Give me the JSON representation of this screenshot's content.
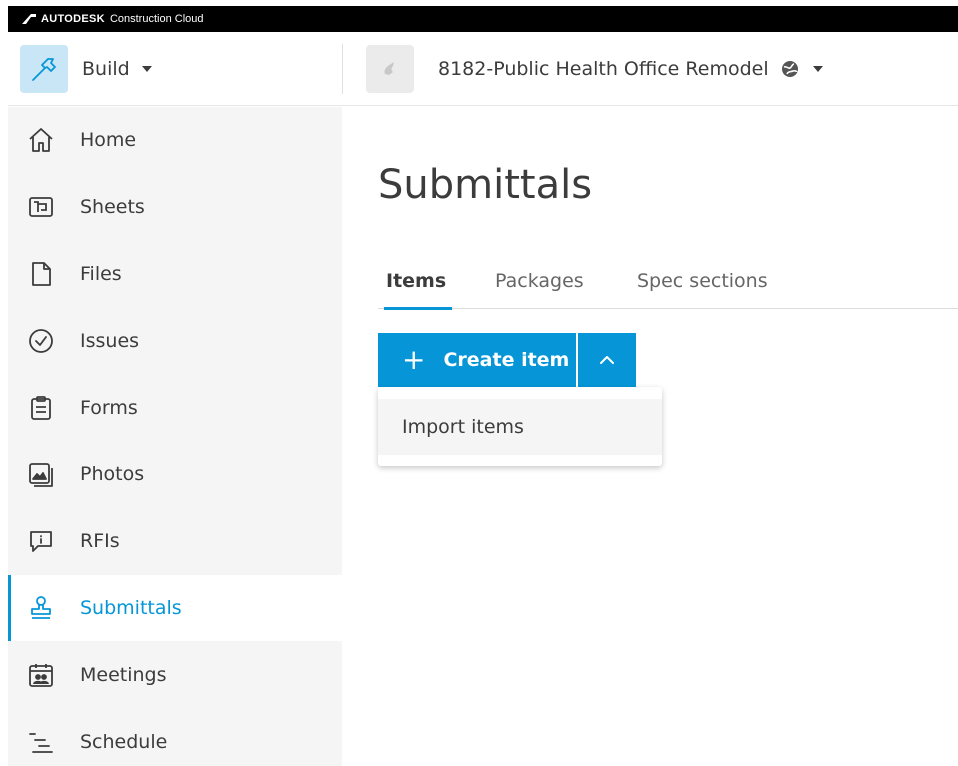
{
  "brand": {
    "name": "AUTODESK",
    "product": "Construction Cloud"
  },
  "header": {
    "app_label": "Build",
    "project_name": "8182-Public Health Office Remodel"
  },
  "sidebar": {
    "items": [
      {
        "label": "Home",
        "icon": "home-icon"
      },
      {
        "label": "Sheets",
        "icon": "sheets-icon"
      },
      {
        "label": "Files",
        "icon": "file-icon"
      },
      {
        "label": "Issues",
        "icon": "issues-check-icon"
      },
      {
        "label": "Forms",
        "icon": "clipboard-icon"
      },
      {
        "label": "Photos",
        "icon": "photos-icon"
      },
      {
        "label": "RFIs",
        "icon": "rfi-speech-icon"
      },
      {
        "label": "Submittals",
        "icon": "stamp-icon",
        "active": true
      },
      {
        "label": "Meetings",
        "icon": "calendar-people-icon"
      },
      {
        "label": "Schedule",
        "icon": "schedule-icon"
      }
    ]
  },
  "main": {
    "title": "Submittals",
    "tabs": [
      {
        "label": "Items",
        "active": true
      },
      {
        "label": "Packages"
      },
      {
        "label": "Spec sections"
      }
    ],
    "create_button": {
      "label": "Create item"
    },
    "dropdown": {
      "items": [
        "Import items"
      ]
    }
  },
  "colors": {
    "accent": "#0696d7",
    "sidebar_bg": "#f5f5f5",
    "topbar_bg": "#000000",
    "text": "#3c3c3c"
  }
}
